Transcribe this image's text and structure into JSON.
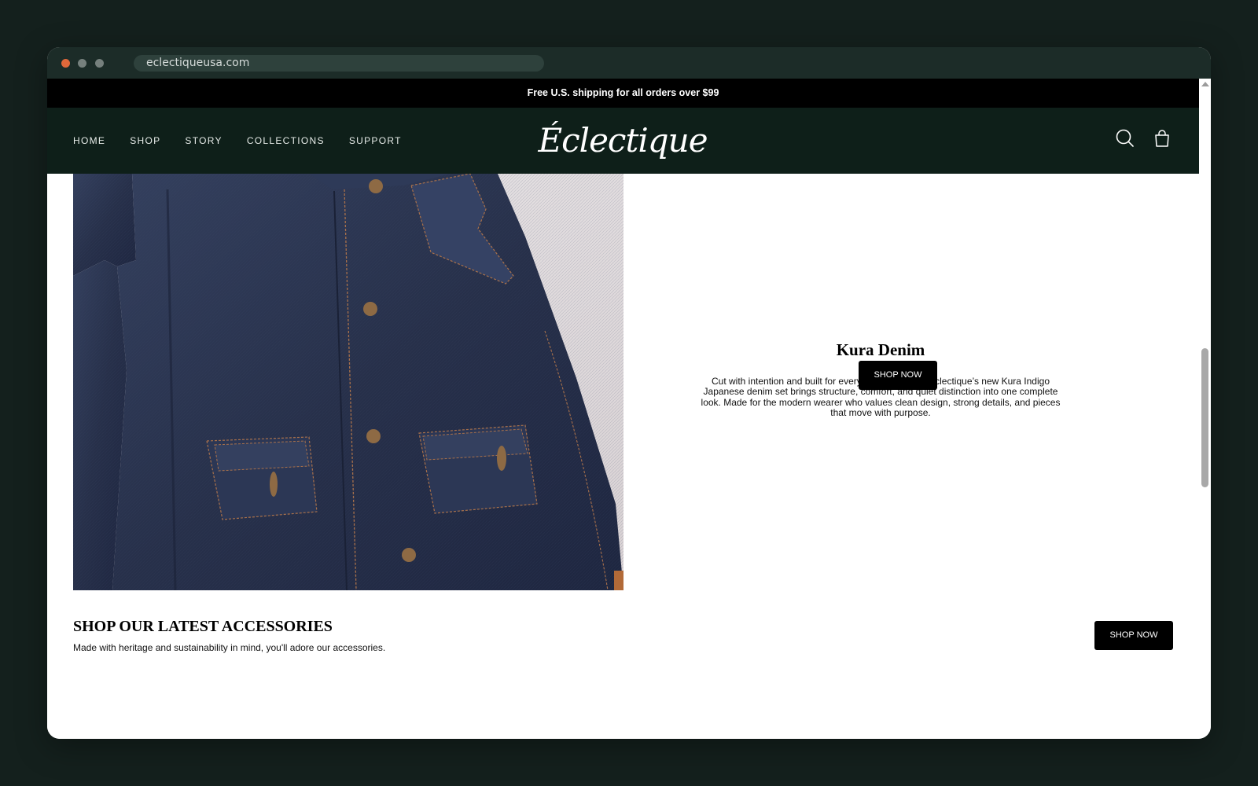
{
  "browser": {
    "url": "eclectiqueusa.com"
  },
  "announcement": {
    "text": "Free U.S. shipping for all orders over $99"
  },
  "header": {
    "logo_text": "Éclectique",
    "nav": [
      {
        "label": "HOME"
      },
      {
        "label": "SHOP"
      },
      {
        "label": "STORY"
      },
      {
        "label": "COLLECTIONS"
      },
      {
        "label": "SUPPORT"
      }
    ],
    "icons": [
      "search-icon",
      "cart-icon"
    ]
  },
  "feature": {
    "image": "denim-jacket-photo",
    "title": "Kura Denim",
    "description": "Cut with intention and built for everyday movement, Éclectique’s new Kura Indigo Japanese denim set brings structure, comfort, and quiet distinction into one complete look. Made for the modern wearer who values clean design, strong details, and pieces that move with purpose.",
    "button_label": "SHOP NOW"
  },
  "accessories": {
    "title": "SHOP OUR LATEST ACCESSORIES",
    "subtitle": "Made with heritage and sustainability in mind, you'll adore our accessories.",
    "button_label": "SHOP NOW"
  },
  "colors": {
    "background": "#14201d",
    "header_bg": "#0e1f19",
    "announcement_bg": "#000000",
    "button_bg": "#000000",
    "denim": "#2a3550"
  }
}
